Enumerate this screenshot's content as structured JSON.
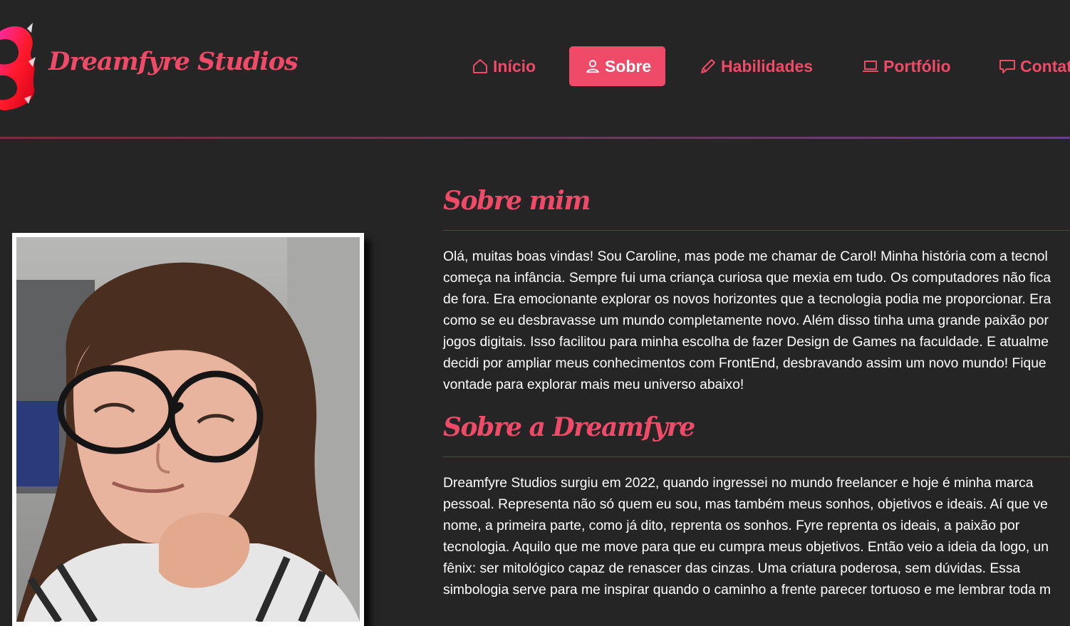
{
  "brand": {
    "name": "Dreamfyre Studios",
    "accent_color": "#ef4a67",
    "background_color": "#252525"
  },
  "nav": {
    "items": [
      {
        "label": "Início",
        "icon": "home-icon",
        "active": false
      },
      {
        "label": "Sobre",
        "icon": "user-icon",
        "active": true
      },
      {
        "label": "Habilidades",
        "icon": "pencil-icon",
        "active": false
      },
      {
        "label": "Portfólio",
        "icon": "laptop-icon",
        "active": false
      },
      {
        "label": "Contat",
        "icon": "chat-icon",
        "active": false
      }
    ]
  },
  "about": {
    "title": "Sobre mim",
    "lines": [
      "Olá, muitas boas vindas! Sou Caroline, mas pode me chamar de Carol! Minha história com a tecnol",
      "começa na infância. Sempre fui uma criança curiosa que mexia em tudo. Os computadores não fica",
      "de fora. Era emocionante explorar os novos horizontes que a tecnologia podia me proporcionar. Era",
      "como se eu desbravasse um mundo completamente novo. Além disso tinha uma grande paixão por",
      "jogos digitais. Isso facilitou para minha escolha de fazer Design de Games na faculdade. E atualme",
      "decidi por ampliar meus conhecimentos com FrontEnd, desbravando assim um novo mundo! Fique",
      "vontade para explorar mais meu universo abaixo!"
    ]
  },
  "dreamfyre": {
    "title": "Sobre a Dreamfyre",
    "lines": [
      "Dreamfyre Studios surgiu em 2022, quando ingressei no mundo freelancer e hoje é minha marca",
      "pessoal. Representa não só quem eu sou, mas também meus sonhos, objetivos e ideais. Aí que ve",
      "nome, a primeira parte, como já dito, reprenta os sonhos. Fyre reprenta os ideais, a paixão por",
      "tecnologia. Aquilo que me move para que eu cumpra meus objetivos. Então veio a ideia da logo, un",
      "fênix: ser mitológico capaz de renascer das cinzas. Uma criatura poderosa, sem dúvidas. Essa",
      "simbologia serve para me inspirar quando o caminho a frente parecer tortuoso e me lembrar toda m"
    ]
  }
}
